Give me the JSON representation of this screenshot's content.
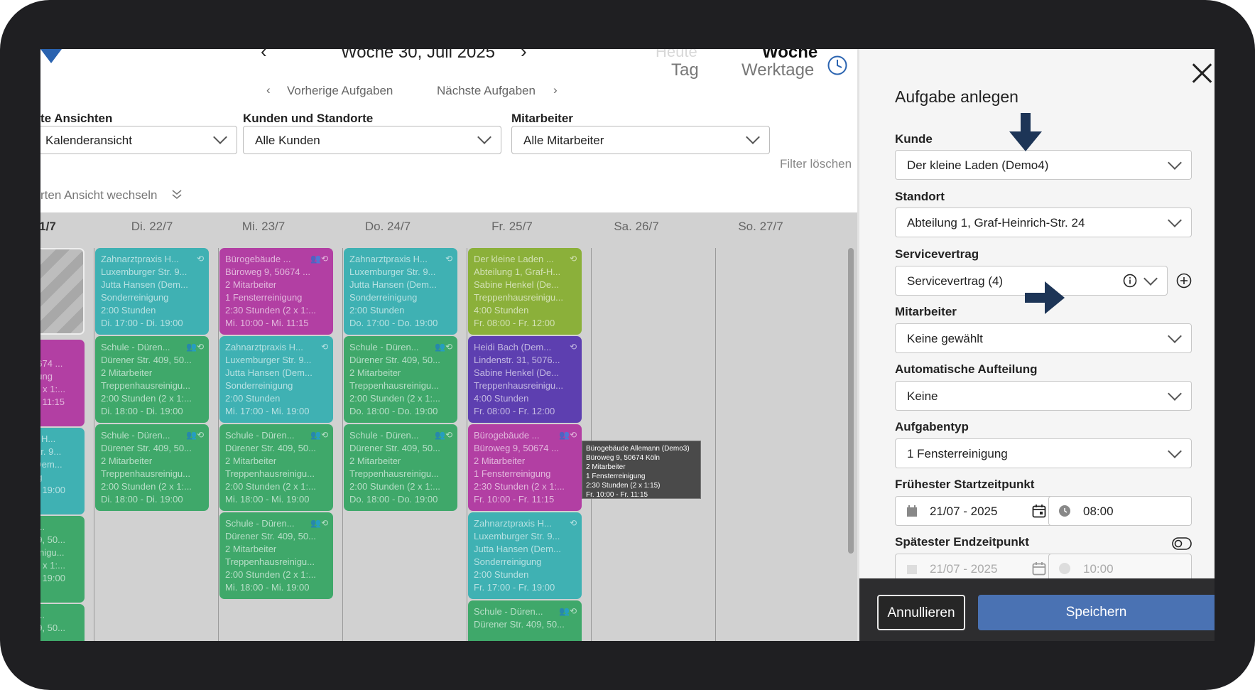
{
  "calendar": {
    "week_title": "Woche 30, Juli 2025",
    "views": {
      "heute": "Heute",
      "tag": "Tag",
      "woche": "Woche",
      "werktage": "Werktage"
    },
    "prev_tasks": "Vorherige Aufgaben",
    "next_tasks": "Nächste Aufgaben",
    "filters": {
      "views_label": "te Ansichten",
      "views_value": "Kalenderansicht",
      "customers_label": "Kunden und Standorte",
      "customers_value": "Alle Kunden",
      "employees_label": "Mitarbeiter",
      "employees_value": "Alle Mitarbeiter",
      "clear": "Filter löschen",
      "switch_view": "rten Ansicht wechseln"
    },
    "days": [
      "1/7",
      "Di. 22/7",
      "Mi. 23/7",
      "Do. 24/7",
      "Fr. 25/7",
      "Sa. 26/7",
      "So. 27/7"
    ],
    "cards": {
      "c0_1": [
        "... ",
        "0674 ...",
        "",
        "gung",
        "(2 x 1:...",
        "o. 11:15"
      ],
      "c0_2": [
        "is H...",
        "Str. 9...",
        "(Dem...",
        "ng",
        "",
        "o. 19:00"
      ],
      "c0_3": [
        "n...",
        "09, 50...",
        "",
        "einigu...",
        "(2 x 1:...",
        "o. 19:00"
      ],
      "c0_4": [
        "n...",
        "09, 50..."
      ],
      "tue_1": [
        "Zahnarztpraxis H...",
        "Luxemburger Str. 9...",
        "Jutta Hansen (Dem...",
        "Sonderreinigung",
        "2:00 Stunden",
        "Di. 17:00 - Di. 19:00"
      ],
      "tue_2": [
        "Schule - Düren...",
        "Dürener Str. 409, 50...",
        "2 Mitarbeiter",
        "Treppenhausreinigu...",
        "2:00 Stunden (2 x 1:...",
        "Di. 18:00 - Di. 19:00"
      ],
      "tue_3": [
        "Schule - Düren...",
        "Dürener Str. 409, 50...",
        "2 Mitarbeiter",
        "Treppenhausreinigu...",
        "2:00 Stunden (2 x 1:...",
        "Di. 18:00 - Di. 19:00"
      ],
      "wed_1": [
        "Bürogebäude ...",
        "Büroweg 9, 50674 ...",
        "2 Mitarbeiter",
        "1 Fensterreinigung",
        "2:30 Stunden (2 x 1:...",
        "Mi. 10:00 - Mi. 11:15"
      ],
      "wed_2": [
        "Zahnarztpraxis H...",
        "Luxemburger Str. 9...",
        "Jutta Hansen (Dem...",
        "Sonderreinigung",
        "2:00 Stunden",
        "Mi. 17:00 - Mi. 19:00"
      ],
      "wed_3": [
        "Schule - Düren...",
        "Dürener Str. 409, 50...",
        "2 Mitarbeiter",
        "Treppenhausreinigu...",
        "2:00 Stunden (2 x 1:...",
        "Mi. 18:00 - Mi. 19:00"
      ],
      "wed_4": [
        "Schule - Düren...",
        "Dürener Str. 409, 50...",
        "2 Mitarbeiter",
        "Treppenhausreinigu...",
        "2:00 Stunden (2 x 1:...",
        "Mi. 18:00 - Mi. 19:00"
      ],
      "thu_1": [
        "Zahnarztpraxis H...",
        "Luxemburger Str. 9...",
        "Jutta Hansen (Dem...",
        "Sonderreinigung",
        "2:00 Stunden",
        "Do. 17:00 - Do. 19:00"
      ],
      "thu_2": [
        "Schule - Düren...",
        "Dürener Str. 409, 50...",
        "2 Mitarbeiter",
        "Treppenhausreinigu...",
        "2:00 Stunden (2 x 1:...",
        "Do. 18:00 - Do. 19:00"
      ],
      "thu_3": [
        "Schule - Düren...",
        "Dürener Str. 409, 50...",
        "2 Mitarbeiter",
        "Treppenhausreinigu...",
        "2:00 Stunden (2 x 1:...",
        "Do. 18:00 - Do. 19:00"
      ],
      "fri_1": [
        "Der kleine Laden ...",
        "Abteilung 1, Graf-H...",
        "Sabine Henkel (De...",
        "Treppenhausreinigu...",
        "4:00 Stunden",
        "Fr. 08:00 - Fr. 12:00"
      ],
      "fri_2": [
        "Heidi Bach (Dem...",
        "Lindenstr. 31, 5076...",
        "Sabine Henkel (De...",
        "Treppenhausreinigu...",
        "4:00 Stunden",
        "Fr. 08:00 - Fr. 12:00"
      ],
      "fri_3": [
        "Bürogebäude ...",
        "Büroweg 9, 50674 ...",
        "2 Mitarbeiter",
        "1 Fensterreinigung",
        "2:30 Stunden (2 x 1:...",
        "Fr. 10:00 - Fr. 11:15"
      ],
      "fri_4": [
        "Zahnarztpraxis H...",
        "Luxemburger Str. 9...",
        "Jutta Hansen (Dem...",
        "Sonderreinigung",
        "2:00 Stunden",
        "Fr. 17:00 - Fr. 19:00"
      ],
      "fri_5": [
        "Schule - Düren...",
        "Dürener Str. 409, 50..."
      ]
    },
    "tooltip": [
      "Bürogebäude Allemann (Demo3)",
      "Büroweg 9, 50674 Köln",
      "2 Mitarbeiter",
      "1 Fensterreinigung",
      "2:30 Stunden (2 x 1:15)",
      "Fr. 10:00 - Fr. 11:15"
    ]
  },
  "panel": {
    "title": "Aufgabe anlegen",
    "kunde_label": "Kunde",
    "kunde_value": "Der kleine Laden (Demo4)",
    "standort_label": "Standort",
    "standort_value": "Abteilung 1, Graf-Heinrich-Str. 24",
    "servicevertrag_label": "Servicevertrag",
    "servicevertrag_value": "Servicevertrag (4)",
    "mitarbeiter_label": "Mitarbeiter",
    "mitarbeiter_value": "Keine gewählt",
    "aufteilung_label": "Automatische Aufteilung",
    "aufteilung_value": "Keine",
    "aufgabentyp_label": "Aufgabentyp",
    "aufgabentyp_value": "1 Fensterreinigung",
    "start_label": "Frühester Startzeitpunkt",
    "start_date": "21/07 - 2025",
    "start_time": "08:00",
    "end_label": "Spätester Endzeitpunkt",
    "end_date": "21/07 - 2025",
    "end_time": "10:00",
    "cancel": "Annullieren",
    "save": "Speichern"
  },
  "colors": {
    "accent": "#4a72b3",
    "arrow": "#1d3557",
    "teal": "#3fb1b3",
    "green": "#3fa86a",
    "magenta": "#b23fa3",
    "olive": "#8bb03a",
    "purple": "#5d3fb0"
  }
}
